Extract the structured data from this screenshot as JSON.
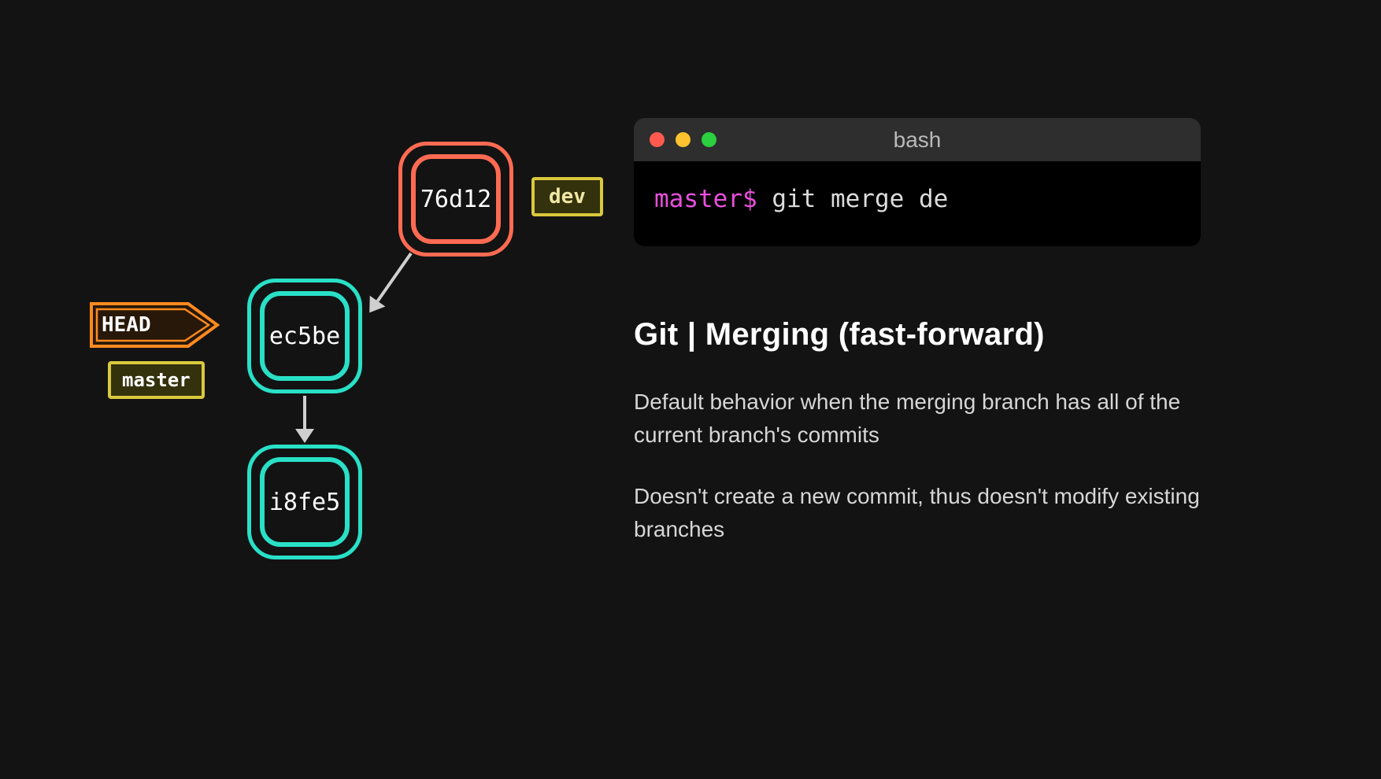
{
  "diagram": {
    "commits": {
      "top": {
        "hash": "76d12",
        "color": "red"
      },
      "middle": {
        "hash": "ec5be",
        "color": "teal"
      },
      "bottom": {
        "hash": "i8fe5",
        "color": "teal"
      }
    },
    "tags": {
      "dev": "dev",
      "head": "HEAD",
      "master": "master"
    }
  },
  "terminal": {
    "title": "bash",
    "prompt": "master$",
    "command": "git merge de"
  },
  "content": {
    "heading": "Git | Merging (fast-forward)",
    "paragraphs": [
      "Default behavior when the merging branch has all of the current branch's commits",
      "Doesn't create a new commit, thus doesn't modify existing branches"
    ]
  },
  "colors": {
    "red": "#ff6b52",
    "teal": "#29e0c7",
    "yellow": "#d9c93d",
    "orange": "#ff8a1f",
    "pink": "#e84fdd"
  }
}
